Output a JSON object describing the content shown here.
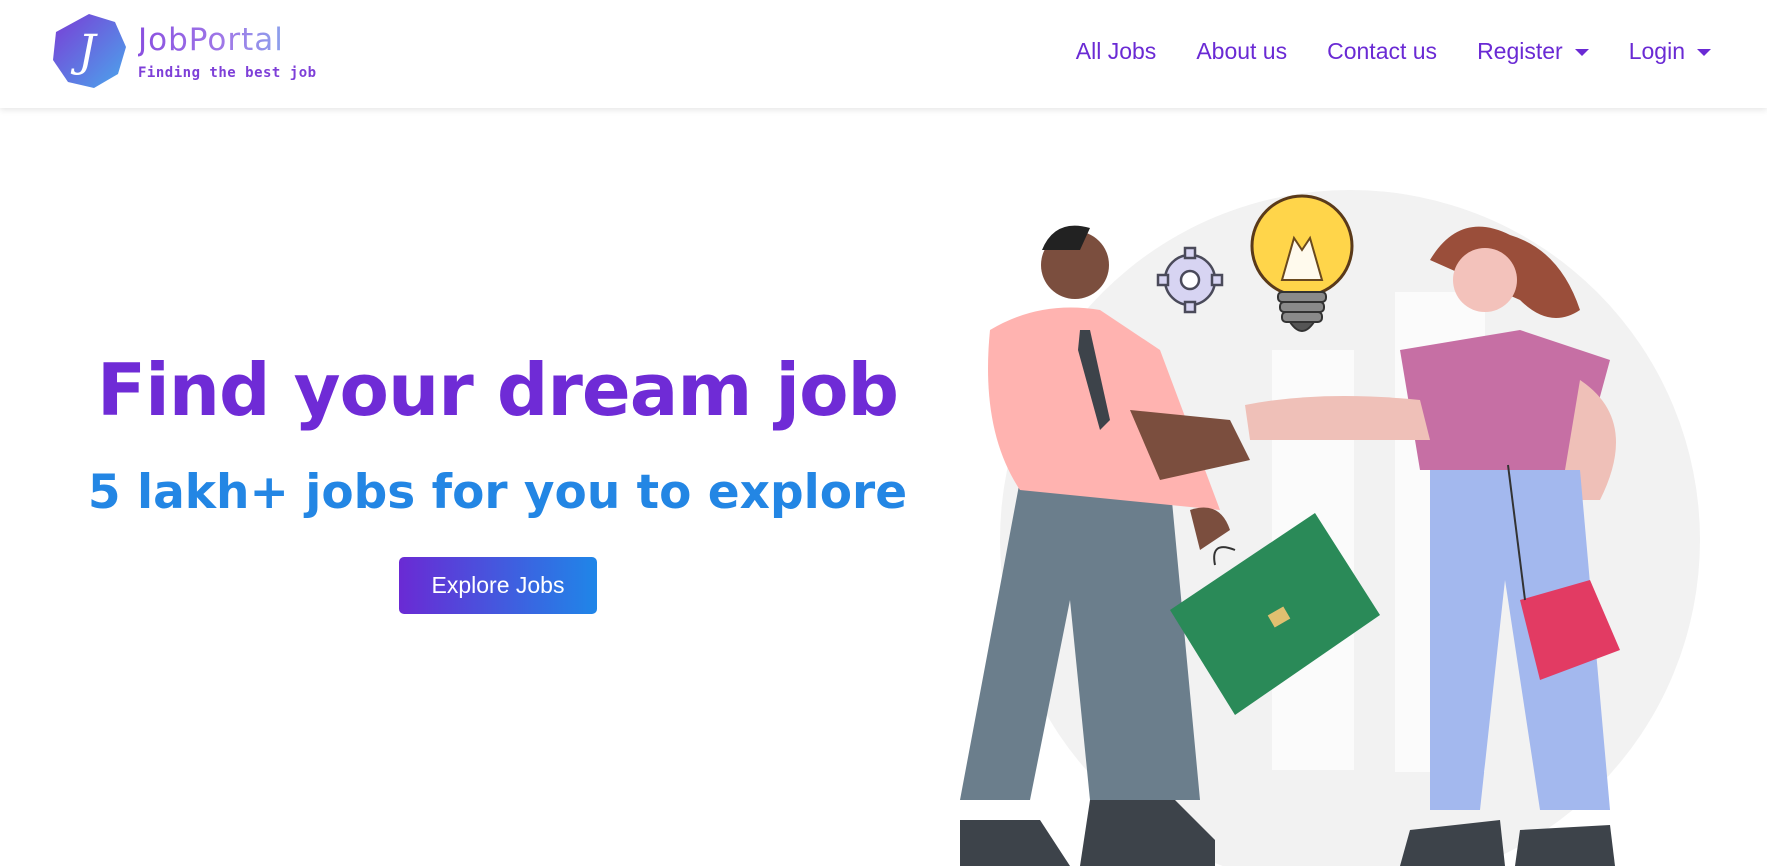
{
  "brand": {
    "name": "JobPortal",
    "tagline": "Finding the best job",
    "logo_letter": "J"
  },
  "nav": {
    "all_jobs": "All Jobs",
    "about": "About us",
    "contact": "Contact us",
    "register": "Register",
    "login": "Login"
  },
  "hero": {
    "title": "Find your dream job",
    "subtitle": "5 lakh+ jobs for you to explore",
    "cta": "Explore Jobs"
  },
  "colors": {
    "primary_purple": "#6f2bd6",
    "accent_blue": "#2386e4",
    "button_gradient_start": "#6a2ad4",
    "button_gradient_end": "#1f86e8"
  },
  "icons": {
    "register_caret": "caret-down-icon",
    "login_caret": "caret-down-icon",
    "illustration": "handshake-illustration"
  }
}
